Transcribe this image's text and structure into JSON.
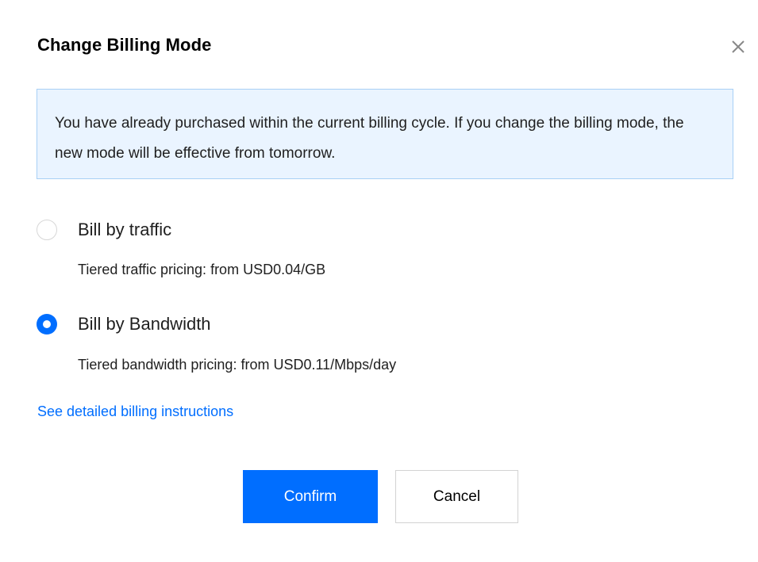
{
  "dialog": {
    "title": "Change Billing Mode"
  },
  "notice": {
    "text": "You have already purchased within the current billing cycle. If you change the billing mode, the new mode will be effective from tomorrow."
  },
  "options": [
    {
      "label": "Bill by traffic",
      "description": "Tiered traffic pricing: from USD0.04/GB",
      "selected": false
    },
    {
      "label": "Bill by Bandwidth",
      "description": "Tiered bandwidth pricing: from USD0.11/Mbps/day",
      "selected": true
    }
  ],
  "link": {
    "text": "See detailed billing instructions"
  },
  "buttons": {
    "confirm": "Confirm",
    "cancel": "Cancel"
  },
  "icons": {
    "close": "close-icon"
  },
  "colors": {
    "accent": "#006eff",
    "notice_bg": "#eaf4ff",
    "notice_border": "#a8d0f5"
  }
}
